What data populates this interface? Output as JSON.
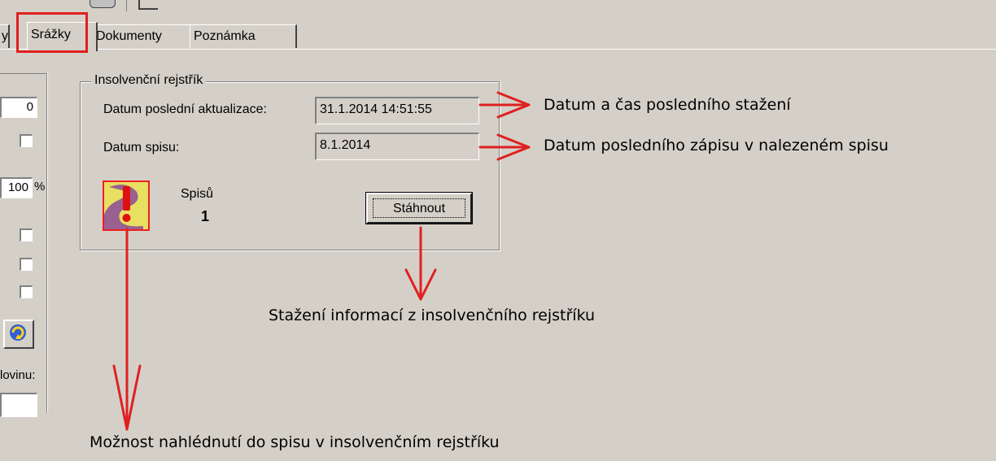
{
  "tabs": {
    "partial_label": "y",
    "srazky": "Srážky",
    "dokumenty": "Dokumenty",
    "poznamka": "Poznámka"
  },
  "left_panel": {
    "field_top_value": "0",
    "percent_value": "100",
    "percent_unit": "%",
    "label_bottom": "lovinu:"
  },
  "insolvency": {
    "group_title": "Insolvenční rejstřík",
    "last_update_label": "Datum poslední aktualizace:",
    "last_update_value": "31.1.2014 14:51:55",
    "file_date_label": "Datum spisu:",
    "file_date_value": "8.1.2014",
    "files_label": "Spisů",
    "files_count": "1",
    "download_button": "Stáhnout"
  },
  "annotations": {
    "last_download": "Datum a čas posledního stažení",
    "last_entry": "Datum posledního zápisu v nalezeném spisu",
    "download_info": "Stažení informací z insolvenčního rejstříku",
    "view_file": "Možnost nahlédnutí do spisu v insolvenčním rejstříku"
  },
  "colors": {
    "window_bg": "#d4d0c8",
    "annotation_red": "#e02020"
  }
}
